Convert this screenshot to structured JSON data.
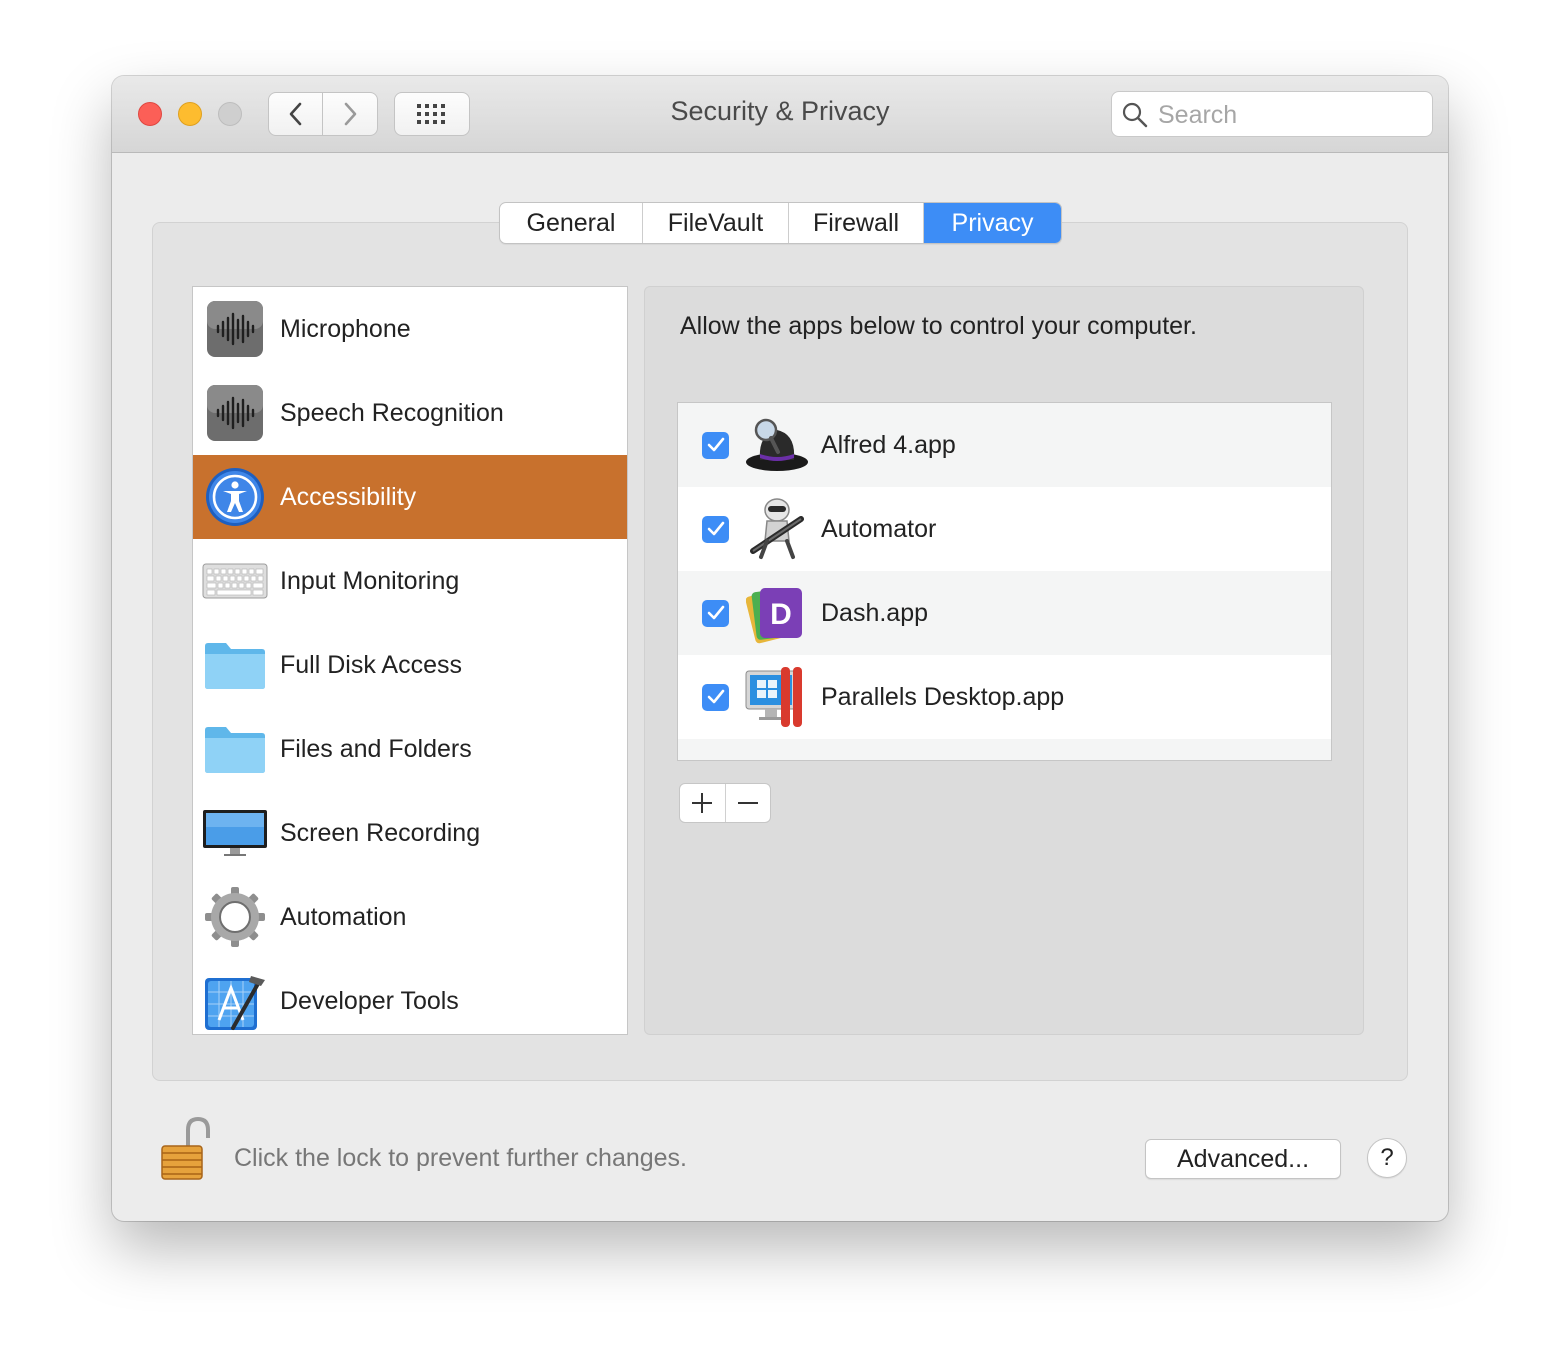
{
  "window": {
    "title": "Security & Privacy",
    "search_placeholder": "Search"
  },
  "toolbar": {
    "back_icon": "chevron-left-icon",
    "forward_icon": "chevron-right-icon",
    "grid_icon": "grid-icon"
  },
  "tabs": [
    {
      "label": "General",
      "active": false
    },
    {
      "label": "FileVault",
      "active": false
    },
    {
      "label": "Firewall",
      "active": false
    },
    {
      "label": "Privacy",
      "active": true
    }
  ],
  "sidebar": {
    "items": [
      {
        "label": "Microphone",
        "icon": "microphone-icon"
      },
      {
        "label": "Speech Recognition",
        "icon": "speech-recognition-icon"
      },
      {
        "label": "Accessibility",
        "icon": "accessibility-icon",
        "selected": true
      },
      {
        "label": "Input Monitoring",
        "icon": "keyboard-icon"
      },
      {
        "label": "Full Disk Access",
        "icon": "folder-icon"
      },
      {
        "label": "Files and Folders",
        "icon": "folder-icon"
      },
      {
        "label": "Screen Recording",
        "icon": "display-icon"
      },
      {
        "label": "Automation",
        "icon": "gear-icon"
      },
      {
        "label": "Developer Tools",
        "icon": "developer-tools-icon"
      }
    ]
  },
  "main": {
    "description": "Allow the apps below to control your computer.",
    "apps": [
      {
        "label": "Alfred 4.app",
        "checked": true,
        "icon": "alfred-icon"
      },
      {
        "label": "Automator",
        "checked": true,
        "icon": "automator-icon"
      },
      {
        "label": "Dash.app",
        "checked": true,
        "icon": "dash-icon"
      },
      {
        "label": "Parallels Desktop.app",
        "checked": true,
        "icon": "parallels-icon"
      }
    ],
    "add_icon": "plus-icon",
    "remove_icon": "minus-icon"
  },
  "footer": {
    "lock_message": "Click the lock to prevent further changes.",
    "advanced_label": "Advanced...",
    "help_label": "?"
  },
  "colors": {
    "accent": "#3d8df6",
    "selection": "#c8712d"
  }
}
